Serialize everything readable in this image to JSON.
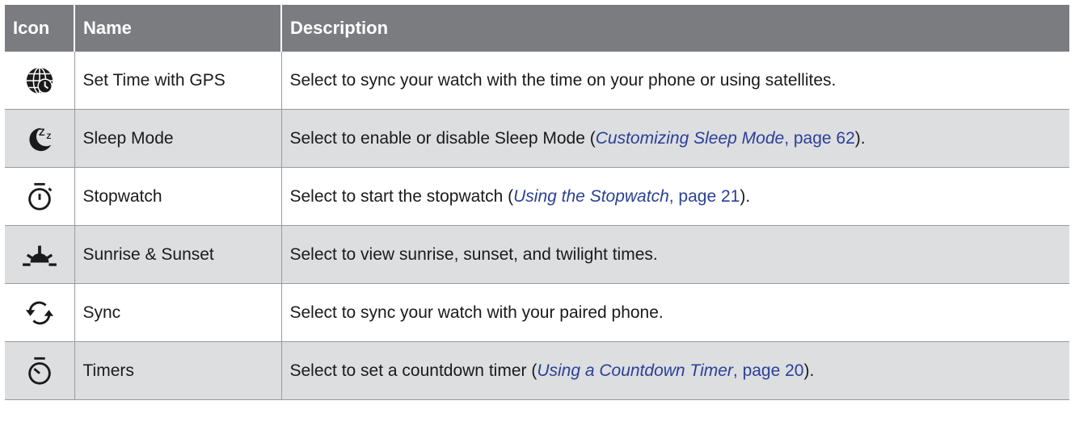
{
  "headers": {
    "icon": "Icon",
    "name": "Name",
    "description": "Description"
  },
  "rows": [
    {
      "icon": "globe-clock-icon",
      "name": "Set Time with GPS",
      "desc_before": "Select to sync your watch with the time on your phone or using satellites.",
      "link_title": "",
      "link_page": "",
      "desc_after": ""
    },
    {
      "icon": "moon-zz-icon",
      "name": "Sleep Mode",
      "desc_before": "Select to enable or disable Sleep Mode (",
      "link_title": "Customizing Sleep Mode",
      "link_page": ", page 62",
      "desc_after": ")."
    },
    {
      "icon": "stopwatch-icon",
      "name": "Stopwatch",
      "desc_before": "Select to start the stopwatch (",
      "link_title": "Using the Stopwatch",
      "link_page": ", page 21",
      "desc_after": ")."
    },
    {
      "icon": "sunrise-icon",
      "name": "Sunrise & Sunset",
      "desc_before": "Select to view sunrise, sunset, and twilight times.",
      "link_title": "",
      "link_page": "",
      "desc_after": ""
    },
    {
      "icon": "sync-icon",
      "name": "Sync",
      "desc_before": "Select to sync your watch with your paired phone.",
      "link_title": "",
      "link_page": "",
      "desc_after": ""
    },
    {
      "icon": "timer-icon",
      "name": "Timers",
      "desc_before": "Select to set a countdown timer (",
      "link_title": "Using a Countdown Timer",
      "link_page": ", page 20",
      "desc_after": ")."
    }
  ],
  "colors": {
    "header_bg": "#7a7c80",
    "alt_row_bg": "#dddee0",
    "link": "#2a3f9a"
  }
}
